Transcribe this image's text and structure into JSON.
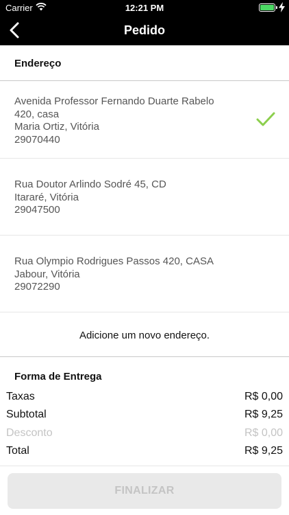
{
  "status_bar": {
    "carrier": "Carrier",
    "time": "12:21 PM",
    "battery_color": "#4cd964"
  },
  "nav": {
    "title": "Pedido",
    "back_icon": "chevron-left-icon"
  },
  "address_section": {
    "header": "Endereço",
    "addresses": [
      {
        "line1": "Avenida Professor Fernando Duarte Rabelo",
        "line2": "420, casa",
        "line3": "Maria Ortiz, Vitória",
        "line4": "29070440",
        "selected": true
      },
      {
        "line1": "Rua Doutor Arlindo Sodré 45, CD",
        "line2": "Itararé, Vitória",
        "line3": "29047500",
        "selected": false
      },
      {
        "line1": "Rua Olympio Rodrigues Passos 420, CASA",
        "line2": "Jabour, Vitória",
        "line3": "29072290",
        "selected": false
      }
    ],
    "add_label": "Adicione um novo endereço.",
    "check_color": "#8ccf4d"
  },
  "delivery_section": {
    "header": "Forma de Entrega"
  },
  "summary": {
    "taxas": {
      "label": "Taxas",
      "value": "R$ 0,00"
    },
    "subtotal": {
      "label": "Subtotal",
      "value": "R$ 9,25"
    },
    "desconto": {
      "label": "Desconto",
      "value": "R$ 0,00"
    },
    "total": {
      "label": "Total",
      "value": "R$ 9,25"
    }
  },
  "finalizar_label": "FINALIZAR"
}
